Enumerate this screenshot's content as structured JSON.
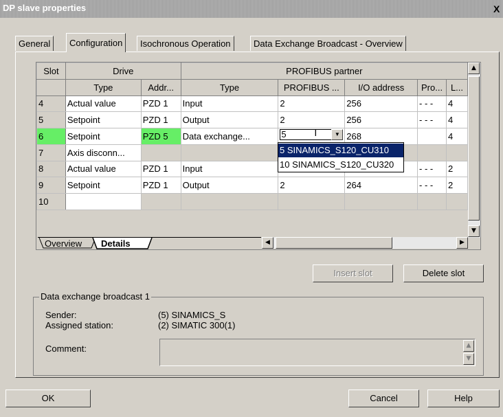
{
  "window": {
    "title": "DP slave properties",
    "close_label": "X"
  },
  "tabs": [
    "General",
    "Configuration",
    "Isochronous Operation",
    "Data Exchange Broadcast - Overview"
  ],
  "table": {
    "header_row1": {
      "slot": "Slot",
      "drive": "Drive",
      "partner": "PROFIBUS partner"
    },
    "header_row2": [
      "Type",
      "Addr...",
      "Type",
      "PROFIBUS ...",
      "I/O address",
      "Pro...",
      "L..."
    ],
    "rows": [
      {
        "slot": "4",
        "type": "Actual value",
        "addr": "PZD 1",
        "ptype": "Input",
        "profibus": "2",
        "io": "256",
        "pro": "- - -",
        "l": "4"
      },
      {
        "slot": "5",
        "type": "Setpoint",
        "addr": "PZD 1",
        "ptype": "Output",
        "profibus": "2",
        "io": "256",
        "pro": "- - -",
        "l": "4"
      },
      {
        "slot": "6",
        "type": "Setpoint",
        "addr": "PZD 5",
        "ptype": "Data exchange...",
        "profibus": "5",
        "io": "268",
        "pro": "",
        "l": "4"
      },
      {
        "slot": "7",
        "type": "Axis disconn...",
        "addr": "",
        "ptype": "",
        "profibus": "",
        "io": "",
        "pro": "",
        "l": ""
      },
      {
        "slot": "8",
        "type": "Actual value",
        "addr": "PZD 1",
        "ptype": "Input",
        "profibus": "",
        "io": "",
        "pro": "- - -",
        "l": "2"
      },
      {
        "slot": "9",
        "type": "Setpoint",
        "addr": "PZD 1",
        "ptype": "Output",
        "profibus": "2",
        "io": "264",
        "pro": "- - -",
        "l": "2"
      },
      {
        "slot": "10",
        "type": "",
        "addr": "",
        "ptype": "",
        "profibus": "",
        "io": "",
        "pro": "",
        "l": ""
      }
    ],
    "dropdown_options": [
      "5 SINAMICS_S120_CU310",
      "10 SINAMICS_S120_CU320"
    ],
    "sheet_tabs": [
      "Overview",
      "Details"
    ]
  },
  "buttons": {
    "insert_slot": "Insert slot",
    "delete_slot": "Delete slot",
    "ok": "OK",
    "cancel": "Cancel",
    "help": "Help"
  },
  "broadcast": {
    "group_title": "Data exchange broadcast 1",
    "sender_label": "Sender:",
    "sender_value": "(5) SINAMICS_S",
    "station_label": "Assigned station:",
    "station_value": "(2) SIMATIC 300(1)",
    "comment_label": "Comment:"
  },
  "colors": {
    "green_cell": "#66ee66",
    "selection": "#0a246a"
  }
}
